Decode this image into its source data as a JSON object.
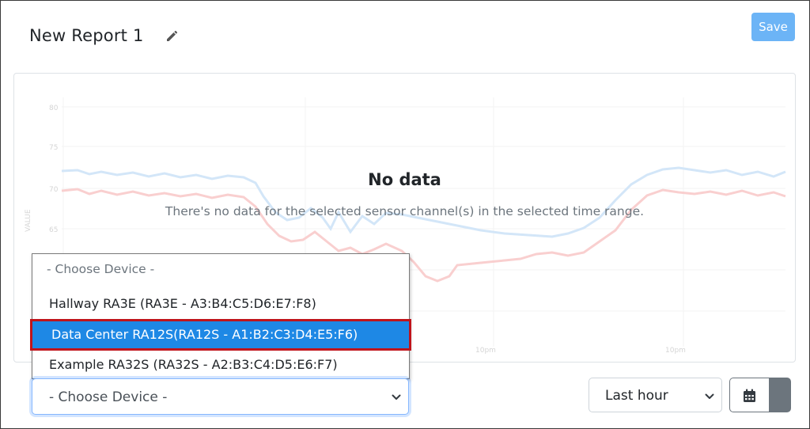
{
  "report": {
    "title": "New Report 1"
  },
  "toolbar": {
    "save_label": "Save"
  },
  "chart": {
    "nodata_title": "No data",
    "nodata_message": "There's no data for the selected sensor channel(s) in the selected time range.",
    "background_ticks": [
      "80",
      "75",
      "70",
      "65"
    ],
    "background_ylabel": "VALUE",
    "background_xticks": [
      "10pm",
      "10pm"
    ]
  },
  "device_dropdown": {
    "placeholder": "- Choose Device -",
    "options": [
      "Hallway RA3E (RA3E - A3:B4:C5:D6:E7:F8)",
      "Data Center RA12S(RA12S - A1:B2:C3:D4:E5:F6)",
      "Example RA32S (RA32S - A2:B3:C4:D5:E6:F7)"
    ],
    "highlighted_index": 1
  },
  "device_select": {
    "value": "- Choose Device -"
  },
  "time_range": {
    "value": "Last hour"
  },
  "colors": {
    "accent": "#1e88e5",
    "save_button": "#6cb4f6",
    "highlight_border": "#c0141b",
    "faint_blue_line": "#cfe3f7",
    "faint_red_line": "#f8c9c9"
  }
}
